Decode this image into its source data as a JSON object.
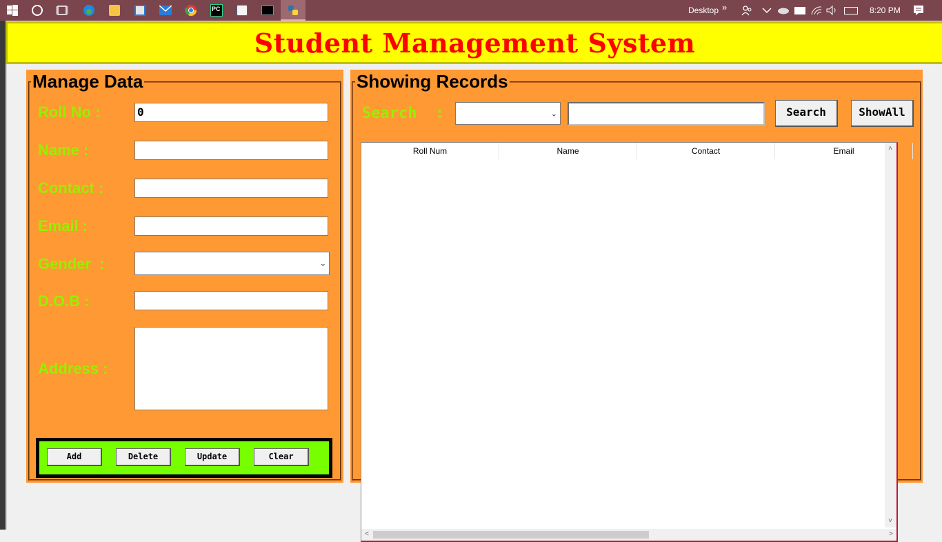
{
  "taskbar": {
    "tray": {
      "desktop_label": "Desktop",
      "chevron": "»",
      "time": "8:20 PM"
    },
    "icons": [
      "windows-start-icon",
      "cortana-icon",
      "task-view-icon",
      "edge-icon",
      "file-explorer-icon",
      "store-icon",
      "mail-icon",
      "chrome-icon",
      "pycharm-icon",
      "python-editor-icon",
      "terminal-icon",
      "python-app-icon"
    ]
  },
  "app": {
    "title": "Student Management System",
    "colors": {
      "header_bg": "#ffff00",
      "title": "#ff0000",
      "panel": "#ff9933",
      "label": "#99ee00",
      "button_bar": "#77ff00"
    }
  },
  "manage": {
    "title": "Manage Data",
    "labels": {
      "roll": "Roll No :",
      "name": "Name :",
      "contact": "Contact :",
      "email": "Email :",
      "gender": "Gender  :",
      "dob": "D.O.B :",
      "address": "Address :"
    },
    "values": {
      "roll": "0",
      "name": "",
      "contact": "",
      "email": "",
      "gender": "",
      "dob": "",
      "address": ""
    },
    "buttons": {
      "add": "Add",
      "delete": "Delete",
      "update": "Update",
      "clear": "Clear"
    }
  },
  "records": {
    "title": "Showing Records",
    "search_label": "Search  :",
    "search_by": "",
    "search_text": "",
    "search_button": "Search",
    "showall_button": "ShowAll",
    "columns": [
      "Roll Num",
      "Name",
      "Contact",
      "Email"
    ],
    "rows": []
  }
}
